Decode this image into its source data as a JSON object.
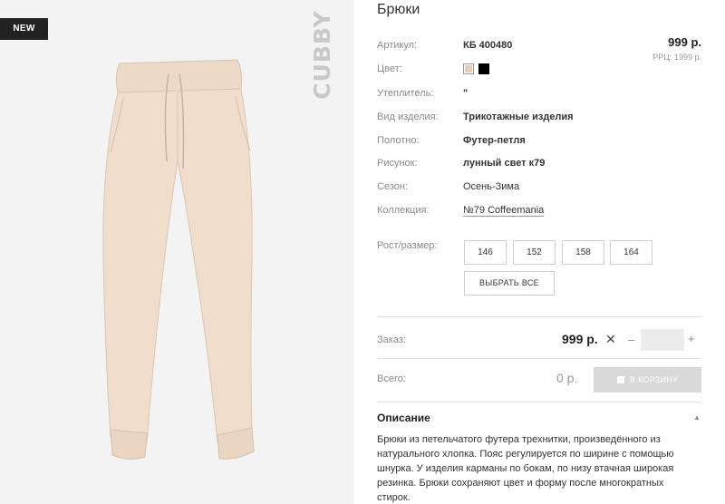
{
  "gallery": {
    "badge": "NEW",
    "brand": "CUBBY"
  },
  "product": {
    "title": "Брюки",
    "price": "999 р.",
    "rrp": "РРЦ: 1999 р.",
    "attributes": [
      {
        "label": "Артикул:",
        "value": "КБ 400480"
      },
      {
        "label": "Цвет:",
        "value": ""
      },
      {
        "label": "Утеплитель:",
        "value": "\""
      },
      {
        "label": "Вид изделия:",
        "value": "Трикотажные изделия"
      },
      {
        "label": "Полотно:",
        "value": "Футер-петля"
      },
      {
        "label": "Рисунок:",
        "value": "лунный свет к79"
      },
      {
        "label": "Сезон:",
        "value": "Осень-Зима"
      },
      {
        "label": "Коллекция:",
        "value": "№79 Coffeemania"
      }
    ],
    "colors": [
      "#e3cfb5",
      "#000000"
    ]
  },
  "sizes": {
    "label": "Рост/размер:",
    "options": [
      "146",
      "152",
      "158",
      "164"
    ],
    "select_all": "ВЫБРАТЬ ВСЕ"
  },
  "order": {
    "label": "Заказ:",
    "price": "999 р.",
    "times": "✕",
    "minus": "–",
    "plus": "+",
    "quantity": ""
  },
  "total": {
    "label": "Всего:",
    "value": "0 р.",
    "cart_button": "В КОРЗИНУ"
  },
  "description": {
    "title": "Описание",
    "toggle": "▲",
    "text": "Брюки из петельчатого футера трехнитки, произведённого из натурального хлопка. Пояс регулируется по ширине с помощью шнурка. У изделия карманы по бокам, по низу втачная широкая резинка. Брюки сохраняют цвет и форму после многократных стирок."
  }
}
